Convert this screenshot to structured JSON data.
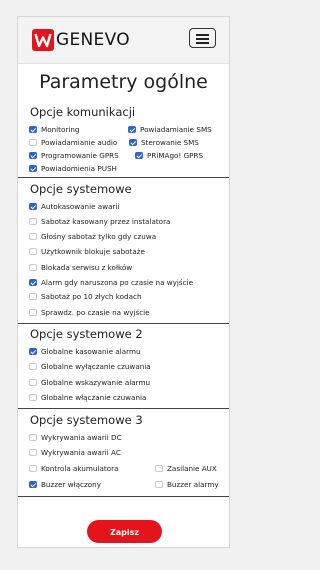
{
  "brand": {
    "name": "GENEVO",
    "accent": "#e3141b"
  },
  "navbar": {
    "menu_icon": "hamburger-menu-icon"
  },
  "page": {
    "title": "Parametry ogólne"
  },
  "sections": {
    "komunikacja": {
      "title": "Opcje komunikacji",
      "items": [
        {
          "label": "Monitoring",
          "checked": true
        },
        {
          "label": "Powiadamianie SMS",
          "checked": true
        },
        {
          "label": "Powiadamianie audio",
          "checked": false
        },
        {
          "label": "Sterowanie SMS",
          "checked": true
        },
        {
          "label": "Programowanie GPRS",
          "checked": true
        },
        {
          "label": "PRiMAgo! GPRS",
          "checked": true
        },
        {
          "label": "Powiadomienia PUSH",
          "checked": true
        }
      ]
    },
    "systemowe": {
      "title": "Opcje systemowe",
      "items": [
        {
          "label": "Autokasowanie awarii",
          "checked": true
        },
        {
          "label": "Sabotaż kasowany przez instalatora",
          "checked": false
        },
        {
          "label": "Głośny sabotaż tylko gdy czuwa",
          "checked": false
        },
        {
          "label": "Użytkownik blokuje sabotaże",
          "checked": false
        },
        {
          "label": "Blokada serwisu z kołków",
          "checked": false
        },
        {
          "label": "Alarm gdy naruszona po czasie na wyjście",
          "checked": true
        },
        {
          "label": "Sabotaż po 10 złych kodach",
          "checked": false
        },
        {
          "label": "Sprawdz. po czasie na wyjście",
          "checked": false
        }
      ]
    },
    "systemowe2": {
      "title": "Opcje systemowe 2",
      "items": [
        {
          "label": "Globalne kasowanie alarmu",
          "checked": true
        },
        {
          "label": "Globalne wyłączanie czuwania",
          "checked": false
        },
        {
          "label": "Globalne wskazywanie alarmu",
          "checked": false
        },
        {
          "label": "Globalne włączanie czuwania",
          "checked": false
        }
      ]
    },
    "systemowe3": {
      "title": "Opcje systemowe 3",
      "items": [
        {
          "label": "Wykrywania awarii DC",
          "checked": false
        },
        {
          "label": "Wykrywania awarii AC",
          "checked": false
        },
        {
          "label": "Kontrola akumulatora",
          "checked": false
        },
        {
          "label": "Zasilanie AUX",
          "checked": false
        },
        {
          "label": "Buzzer włączony",
          "checked": true
        },
        {
          "label": "Buzzer alarmy",
          "checked": false
        }
      ]
    }
  },
  "actions": {
    "save_label": "Zapisz"
  }
}
